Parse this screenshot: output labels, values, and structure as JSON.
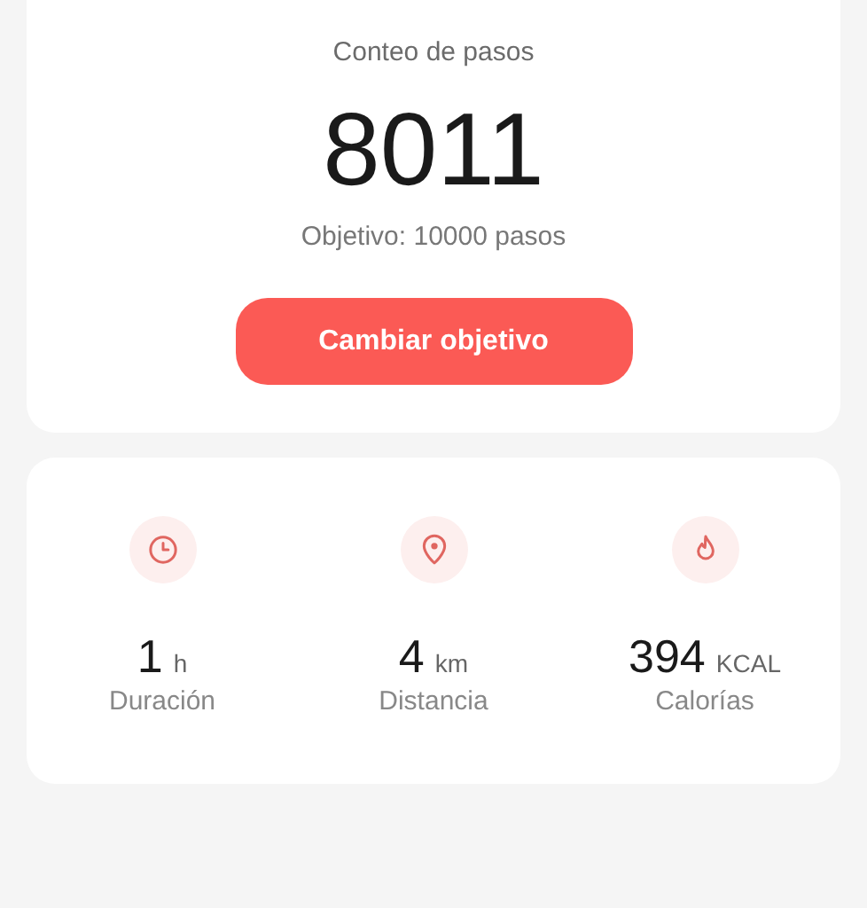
{
  "steps": {
    "title": "Conteo de pasos",
    "count": "8011",
    "goal": "Objetivo: 10000 pasos",
    "button": "Cambiar objetivo"
  },
  "stats": [
    {
      "kind": "clock",
      "value": "1",
      "unit": "h",
      "label": "Duración"
    },
    {
      "kind": "pin",
      "value": "4",
      "unit": "km",
      "label": "Distancia"
    },
    {
      "kind": "flame",
      "value": "394",
      "unit": "KCAL",
      "label": "Calorías"
    }
  ]
}
